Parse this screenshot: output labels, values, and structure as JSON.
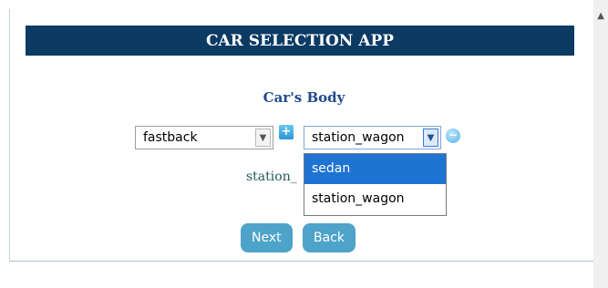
{
  "app": {
    "title": "CAR SELECTION APP"
  },
  "form": {
    "section_title": "Car's Body",
    "left_select": {
      "value": "fastback"
    },
    "right_select": {
      "value": "station_wagon"
    },
    "behind_text": "station_"
  },
  "dropdown": {
    "options": [
      "sedan",
      "station_wagon"
    ],
    "highlighted": "sedan"
  },
  "buttons": {
    "next": "Next",
    "back": "Back"
  },
  "icons": {
    "add": "plus-icon",
    "remove": "minus-icon"
  },
  "colors": {
    "header_bg": "#0b3a63",
    "button_bg": "#4da3c9",
    "highlight": "#1e73d3"
  }
}
